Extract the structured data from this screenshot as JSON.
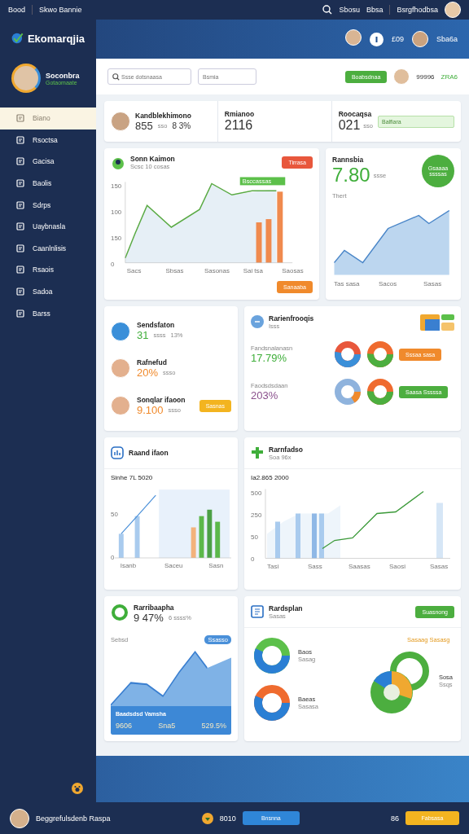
{
  "top_bar": {
    "left": [
      "Bood",
      "Skwo Bannie"
    ],
    "links": [
      "Sbosu",
      "Bbsa",
      "Bsrgfhodbsa"
    ]
  },
  "sidebar": {
    "brand": "Ekomarqjia",
    "profile": {
      "name": "Soconbra",
      "subtitle": "Gotaomaate"
    },
    "items": [
      {
        "label": "Biano",
        "selected": true
      },
      {
        "label": "Rsoctsa",
        "selected": false
      },
      {
        "label": "Gacisa",
        "selected": false
      },
      {
        "label": "Baolis",
        "selected": false
      },
      {
        "label": "Sdrps",
        "selected": false
      },
      {
        "label": "Uaybnasla",
        "selected": false
      },
      {
        "label": "Caanlnlisis",
        "selected": false
      },
      {
        "label": "Rsaois",
        "selected": false
      },
      {
        "label": "Sadoa",
        "selected": false
      },
      {
        "label": "Barss",
        "selected": false
      }
    ]
  },
  "header": {
    "count": "£09",
    "user": "Sba6a"
  },
  "toolbar": {
    "search_placeholder": "Ssse dotsnaasa",
    "field_placeholder": "Bsmia",
    "button": "Boabsdnaa",
    "user": "99996",
    "user_value": "ZRA6"
  },
  "summary": [
    {
      "title": "Kandblekhimono",
      "value": "855",
      "unit": "sso",
      "value2": "8 3%"
    },
    {
      "title": "Rmianoo",
      "value": "2116"
    },
    {
      "title": "Roocaqsa",
      "value": "021",
      "unit": "sso",
      "tag": "Balfiara"
    }
  ],
  "sales_chart": {
    "title": "Sonn Kaimon",
    "subtitle": "Scsc 10 cosas",
    "button": "Tirrasa",
    "tag": "Bsccassas",
    "y_labels": [
      "150",
      "100",
      "150",
      "0"
    ],
    "x_labels": [
      "Sacs",
      "Sbsas",
      "Sasonas",
      "Sai tsa",
      "Saosas"
    ],
    "action": "Sanaaba"
  },
  "rate_card": {
    "title": "Rannsbia",
    "value": "7.80",
    "unit": "ssse",
    "badge": "Gsaaaa ssssas",
    "label": "Thert",
    "x_labels": [
      "Tas sasa",
      "Sacos",
      "Sasas"
    ]
  },
  "stats": [
    {
      "title": "Sendsfaton",
      "value": "31",
      "unit": "ssss",
      "value2": "13%",
      "color": "#3fae3a"
    },
    {
      "title": "Rafnefud",
      "value": "20%",
      "unit": "ssso",
      "color": "#f08a2c"
    },
    {
      "title": "Sonqlar ifaoon",
      "value": "9.100",
      "unit": "ssso",
      "button": "Sasnas",
      "color": "#f08a2c"
    }
  ],
  "ratios": {
    "title": "Rarienfrooqis",
    "subtitle": "Isss",
    "rows": [
      {
        "label": "Fandsnalanasn",
        "value": "17.79%",
        "button": "Sssaa sasa",
        "color": "#3fae3a"
      },
      {
        "label": "Faodsdsdaan",
        "value": "203%",
        "button": "Saasa Sssssa",
        "color": "#8a4f8c"
      }
    ]
  },
  "bars_card": {
    "title": "Raand ifaon",
    "label": "Sinhe 7L 5020",
    "y_labels": [
      "50",
      "0"
    ],
    "x_labels": [
      "Isanb",
      "Saceu",
      "Sasn"
    ]
  },
  "trend_card": {
    "title": "Rarnfadso",
    "subtitle": "Soa 96x",
    "label": "Ia2.865 2000",
    "y_labels": [
      "500",
      "250",
      "50",
      "0"
    ],
    "x_labels": [
      "Tasi",
      "Sass",
      "Saasas",
      "Saosi",
      "Sasas"
    ]
  },
  "growth_card": {
    "title": "Rarribaapha",
    "value": "9 47%",
    "value2": "6 ssss%",
    "label": "Sebsd",
    "tag": "Ssasso",
    "banner_title": "Baadsdsd Vamsha",
    "banner_values": [
      "9606",
      "Sna5",
      "529.5%"
    ]
  },
  "share_card": {
    "title": "Rardsplan",
    "subtitle": "Sasas",
    "button": "Suasnong",
    "legend": [
      {
        "name": "Baos",
        "value": "Sasag"
      },
      {
        "name": "Baeas",
        "value": "Sasasa"
      },
      {
        "name": "Sosa",
        "value": "Ssqs"
      }
    ],
    "annotation": "Sasaag Sasasg"
  },
  "footer": {
    "user": "Beggrefulsdenb Raspa",
    "count": "8010",
    "button": "Bnsnna",
    "count2": "86",
    "button2": "Fabsasa"
  }
}
